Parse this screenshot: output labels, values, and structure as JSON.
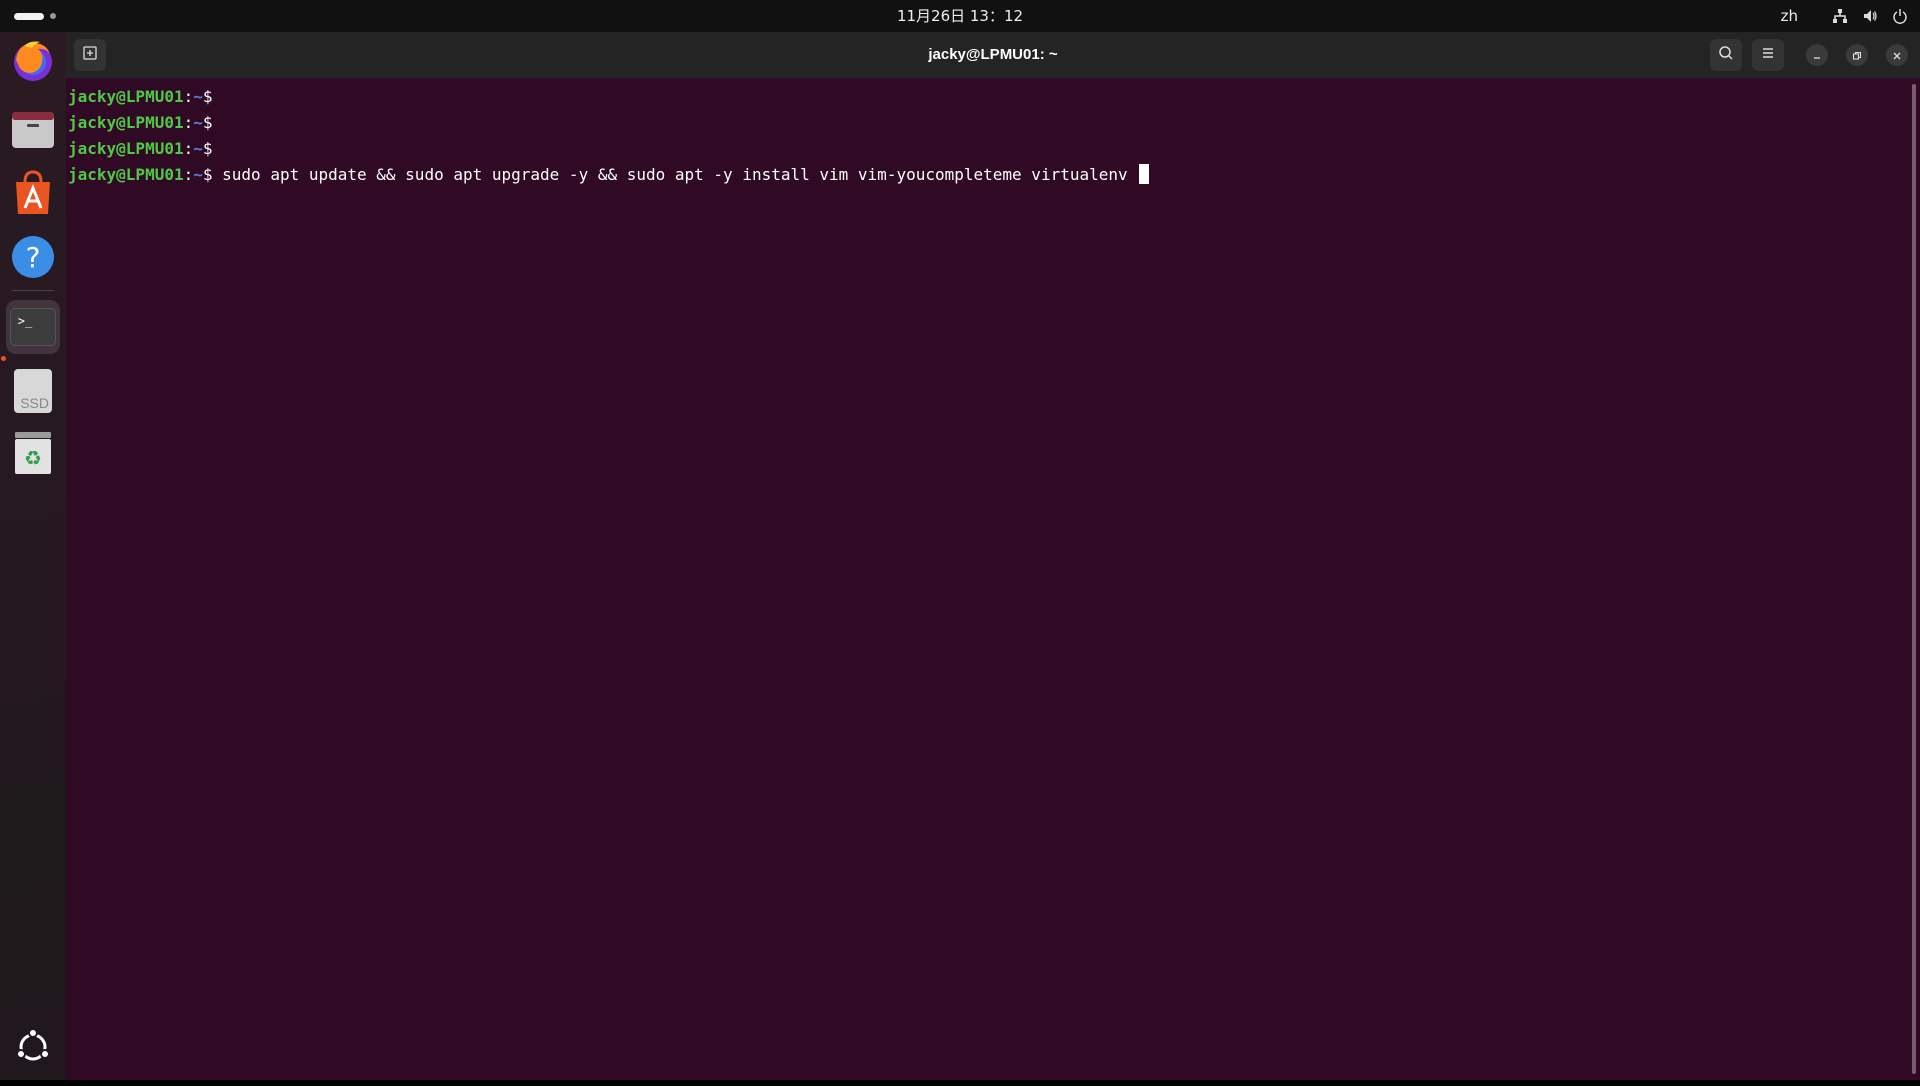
{
  "topbar": {
    "clock": "11月26日 13：12",
    "language": "zh",
    "tray_icons": [
      "network-icon",
      "volume-icon",
      "power-icon"
    ]
  },
  "dock": {
    "items": [
      {
        "name": "firefox",
        "icon": "firefox-icon"
      },
      {
        "name": "files",
        "icon": "folder-icon"
      },
      {
        "name": "app-center",
        "icon": "app-center-icon"
      },
      {
        "name": "help",
        "icon": "help-icon"
      },
      {
        "name": "terminal",
        "icon": "terminal-icon",
        "active": true
      },
      {
        "name": "ssd-drive",
        "icon": "drive-icon",
        "label": "SSD"
      },
      {
        "name": "trash",
        "icon": "trash-icon"
      },
      {
        "name": "show-apps",
        "icon": "ubuntu-logo-icon"
      }
    ],
    "ssd_label": "SSD",
    "terminal_glyph": ">_"
  },
  "window": {
    "title": "jacky@LPMU01: ~",
    "buttons": [
      "new-tab",
      "search",
      "menu",
      "minimize",
      "restore",
      "close"
    ]
  },
  "terminal": {
    "prompt_user": "jacky@LPMU01",
    "prompt_colon": ":",
    "prompt_path": "~",
    "prompt_symbol": "$",
    "lines": [
      {
        "command": ""
      },
      {
        "command": ""
      },
      {
        "command": ""
      },
      {
        "command": " sudo apt update && sudo apt upgrade -y && sudo apt -y install vim vim-youcompleteme virtualenv "
      }
    ]
  },
  "colors": {
    "terminal_bg": "#300a24",
    "prompt_user": "#4ec944",
    "prompt_path": "#5a7fd6",
    "accent": "#e95420",
    "headerbar_bg": "#242424"
  }
}
